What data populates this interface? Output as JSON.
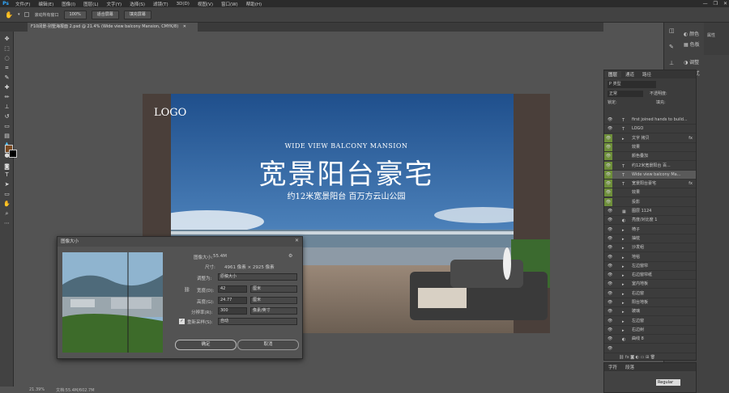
{
  "menu": {
    "logo": "Ps",
    "items": [
      "文件(F)",
      "编辑(E)",
      "图像(I)",
      "图层(L)",
      "文字(Y)",
      "选择(S)",
      "滤镜(T)",
      "3D(D)",
      "视图(V)",
      "窗口(W)",
      "帮助(H)"
    ],
    "minimize": "—",
    "restore": "❐",
    "close": "✕"
  },
  "options": {
    "scroll_all_label": "滚动所有窗口",
    "zoom_value": "100%",
    "fit_screen": "适合屏幕",
    "fill_screen": "填充屏幕"
  },
  "document": {
    "tab_title": "F10阔景-别墅海报面 2.psd @ 21.4% (Wide view balcony Mansion, CMYK/8)",
    "tab_close": "✕"
  },
  "status": {
    "zoom": "21.39%",
    "doc_size": "文档:55.4M/602.7M"
  },
  "poster": {
    "logo": "LOGO",
    "subtitle_en": "WIDE VIEW BALCONY MANSION",
    "headline": "宽景阳台豪宅",
    "tagline": "约12米宽景阳台  百万方云山公园"
  },
  "right_panels": {
    "col2": [
      {
        "icon": "palette-icon",
        "label": "颜色"
      },
      {
        "icon": "swatches-icon",
        "label": "色板"
      },
      {
        "icon": "adjust-icon",
        "label": "调整"
      },
      {
        "icon": "styles-icon",
        "label": "样式"
      }
    ],
    "strip_label": "属性"
  },
  "layers_panel": {
    "tabs": [
      "图层",
      "通道",
      "路径"
    ],
    "search_placeholder": "P 类型",
    "blend_mode": "正常",
    "opacity_label": "不透明度:",
    "lock_label": "锁定:",
    "fill_label": "填充:",
    "layers": [
      {
        "name": "first joined hands to build...",
        "icon": "T",
        "fx": ""
      },
      {
        "name": "LOGO",
        "icon": "T",
        "fx": ""
      },
      {
        "name": "文字 拷贝",
        "icon": "▸",
        "fx": "fx"
      },
      {
        "name": "效果",
        "icon": "",
        "fx": ""
      },
      {
        "name": "颜色叠加",
        "icon": "",
        "fx": ""
      },
      {
        "name": "约12米宽景阳台 百...",
        "icon": "T",
        "fx": ""
      },
      {
        "name": "Wide view balcony Ma...",
        "icon": "T",
        "fx": ""
      },
      {
        "name": "宽景阳台豪宅",
        "icon": "T",
        "fx": "fx"
      },
      {
        "name": "效果",
        "icon": "",
        "fx": ""
      },
      {
        "name": "投影",
        "icon": "",
        "fx": ""
      },
      {
        "name": "图层 1124",
        "icon": "▦",
        "fx": ""
      },
      {
        "name": "亮度/对比度 1",
        "icon": "◐",
        "fx": ""
      },
      {
        "name": "椅子",
        "icon": "▸",
        "fx": ""
      },
      {
        "name": "抽枕",
        "icon": "▸",
        "fx": ""
      },
      {
        "name": "沙发组",
        "icon": "▸",
        "fx": ""
      },
      {
        "name": "地毯",
        "icon": "▸",
        "fx": ""
      },
      {
        "name": "左边窗帘",
        "icon": "▸",
        "fx": ""
      },
      {
        "name": "右边窗帘纸",
        "icon": "▸",
        "fx": ""
      },
      {
        "name": "室内地板",
        "icon": "▸",
        "fx": ""
      },
      {
        "name": "右边窗",
        "icon": "▸",
        "fx": ""
      },
      {
        "name": "阳台地板",
        "icon": "▸",
        "fx": ""
      },
      {
        "name": "玻璃",
        "icon": "▸",
        "fx": ""
      },
      {
        "name": "左边窗",
        "icon": "▸",
        "fx": ""
      },
      {
        "name": "右边树",
        "icon": "▸",
        "fx": ""
      },
      {
        "name": "曲线 8",
        "icon": "◐",
        "fx": ""
      },
      {
        "name": "",
        "icon": "",
        "fx": ""
      }
    ]
  },
  "char_panel": {
    "tabs": [
      "字符",
      "段落"
    ],
    "font_style": "Regular"
  },
  "dialog": {
    "title": "图像大小",
    "image_size_label": "图像大小:",
    "image_size_value": "55.4M",
    "dimensions_label": "尺寸:",
    "dimensions_value": "4961 像素 × 2925 像素",
    "fit_label": "调整为:",
    "fit_value": "原稿大小",
    "width_label": "宽度(D):",
    "width_value": "42",
    "width_unit": "厘米",
    "height_label": "高度(G):",
    "height_value": "24.77",
    "height_unit": "厘米",
    "resolution_label": "分辨率(R):",
    "resolution_value": "300",
    "resolution_unit": "像素/英寸",
    "resample_label": "重新采样(S):",
    "resample_value": "自动",
    "ok": "确定",
    "cancel": "取消",
    "close": "✕"
  }
}
